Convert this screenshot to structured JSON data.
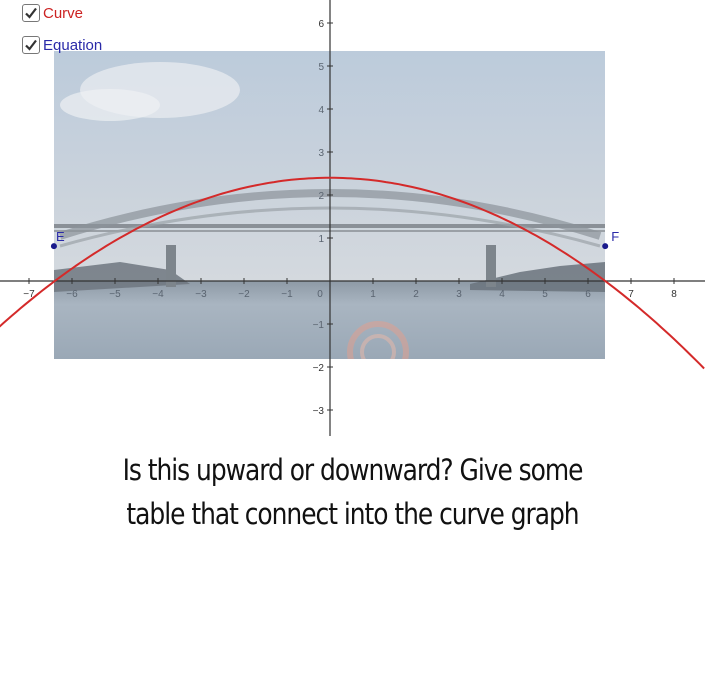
{
  "controls": {
    "curve_checkbox": {
      "label": "Curve",
      "checked": true,
      "color": "#cc2222"
    },
    "equation_checkbox": {
      "label": "Equation",
      "checked": true,
      "color": "#2a2aa8"
    }
  },
  "question": {
    "line1": "Is this upward or downward? Give some",
    "line2": "table that connect into the curve graph"
  },
  "chart_data": {
    "type": "line",
    "title": "",
    "xlabel": "",
    "ylabel": "",
    "xlim": [
      -7.7,
      8.7
    ],
    "ylim": [
      -3.5,
      6.5
    ],
    "grid": false,
    "x_ticks": [
      -7,
      -6,
      -5,
      -4,
      -3,
      -2,
      -1,
      0,
      1,
      2,
      3,
      4,
      5,
      6,
      7,
      8
    ],
    "y_ticks": [
      -3,
      -2,
      -1,
      1,
      2,
      3,
      4,
      5,
      6
    ],
    "background_image": "photo of arch bridge over water",
    "background_image_extent": {
      "x": [
        -6.42,
        6.4
      ],
      "y": [
        -1.8,
        5.4
      ]
    },
    "series": [
      {
        "name": "Curve",
        "color": "#d42a2a",
        "kind": "parabola (opens downward)",
        "equation_estimate": "y = 2.4 - 0.058x^2",
        "vertex": [
          0,
          2.4
        ],
        "x_intercepts": [
          -6.4,
          6.4
        ],
        "sample_points": [
          {
            "x": -8,
            "y": -1.31
          },
          {
            "x": -6,
            "y": 0.31
          },
          {
            "x": -4,
            "y": 1.47
          },
          {
            "x": -2,
            "y": 2.17
          },
          {
            "x": 0,
            "y": 2.4
          },
          {
            "x": 2,
            "y": 2.17
          },
          {
            "x": 4,
            "y": 1.47
          },
          {
            "x": 6,
            "y": 0.31
          },
          {
            "x": 8,
            "y": -1.31
          }
        ]
      }
    ],
    "points": [
      {
        "label": "E",
        "x": -6.42,
        "y": 0.81,
        "color": "#1a1a8c"
      },
      {
        "label": "F",
        "x": 6.4,
        "y": 0.81,
        "color": "#1a1a8c"
      }
    ]
  }
}
